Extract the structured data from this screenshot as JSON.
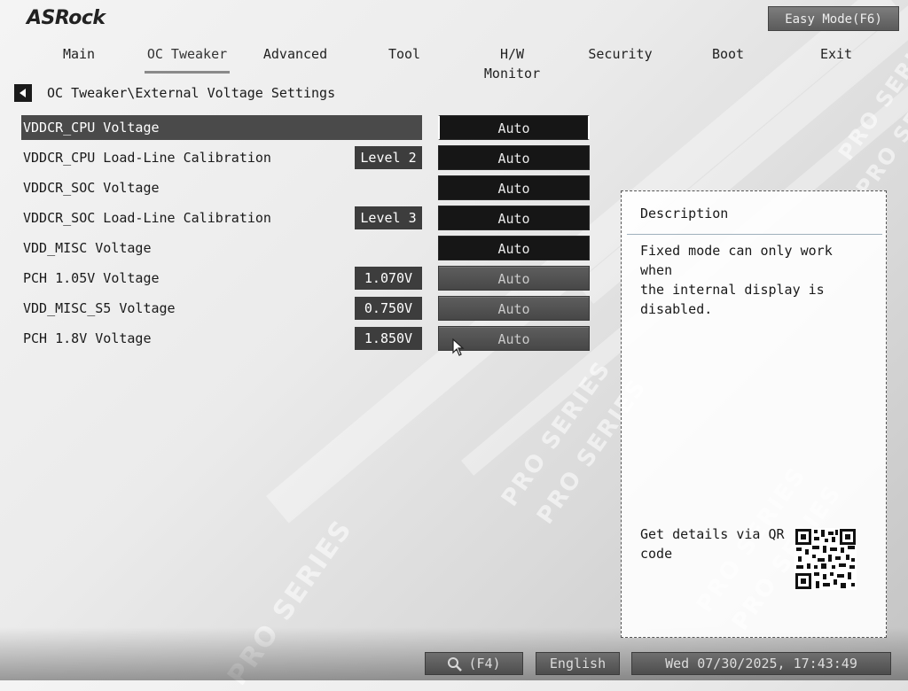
{
  "brand": {
    "logo_text": "ASRock",
    "watermark_text": "PRO SERIES"
  },
  "header": {
    "easy_mode_label": "Easy Mode(F6)"
  },
  "nav": {
    "tabs": [
      {
        "label": "Main"
      },
      {
        "label": "OC Tweaker"
      },
      {
        "label": "Advanced"
      },
      {
        "label": "Tool"
      },
      {
        "label": "H/W Monitor"
      },
      {
        "label": "Security"
      },
      {
        "label": "Boot"
      },
      {
        "label": "Exit"
      }
    ],
    "active": "OC Tweaker"
  },
  "breadcrumb": {
    "path": "OC Tweaker\\External Voltage Settings"
  },
  "settings": [
    {
      "label": "VDDCR_CPU Voltage",
      "current": "",
      "value": "Auto",
      "enabled": true,
      "selected": true
    },
    {
      "label": "VDDCR_CPU Load-Line Calibration",
      "current": "Level 2",
      "value": "Auto",
      "enabled": true,
      "selected": false
    },
    {
      "label": "VDDCR_SOC Voltage",
      "current": "",
      "value": "Auto",
      "enabled": true,
      "selected": false
    },
    {
      "label": "VDDCR_SOC Load-Line Calibration",
      "current": "Level 3",
      "value": "Auto",
      "enabled": true,
      "selected": false
    },
    {
      "label": "VDD_MISC Voltage",
      "current": "",
      "value": "Auto",
      "enabled": true,
      "selected": false
    },
    {
      "label": "PCH 1.05V Voltage",
      "current": "1.070V",
      "value": "Auto",
      "enabled": false,
      "selected": false
    },
    {
      "label": "VDD_MISC_S5 Voltage",
      "current": "0.750V",
      "value": "Auto",
      "enabled": false,
      "selected": false
    },
    {
      "label": "PCH 1.8V Voltage",
      "current": "1.850V",
      "value": "Auto",
      "enabled": false,
      "selected": false
    }
  ],
  "description": {
    "title": "Description",
    "body": "Fixed mode can only work when\nthe internal display is\ndisabled.",
    "qr_text": "Get details via QR code"
  },
  "footer": {
    "search_label": "(F4)",
    "search_icon": "magnifier-icon",
    "language": "English",
    "datetime": "Wed 07/30/2025, 17:43:49"
  },
  "colors": {
    "selected_row": "#4a4a4a",
    "value_box": "#161616",
    "value_box_disabled": "#555555",
    "tab_underline": "#8a8a8a"
  }
}
